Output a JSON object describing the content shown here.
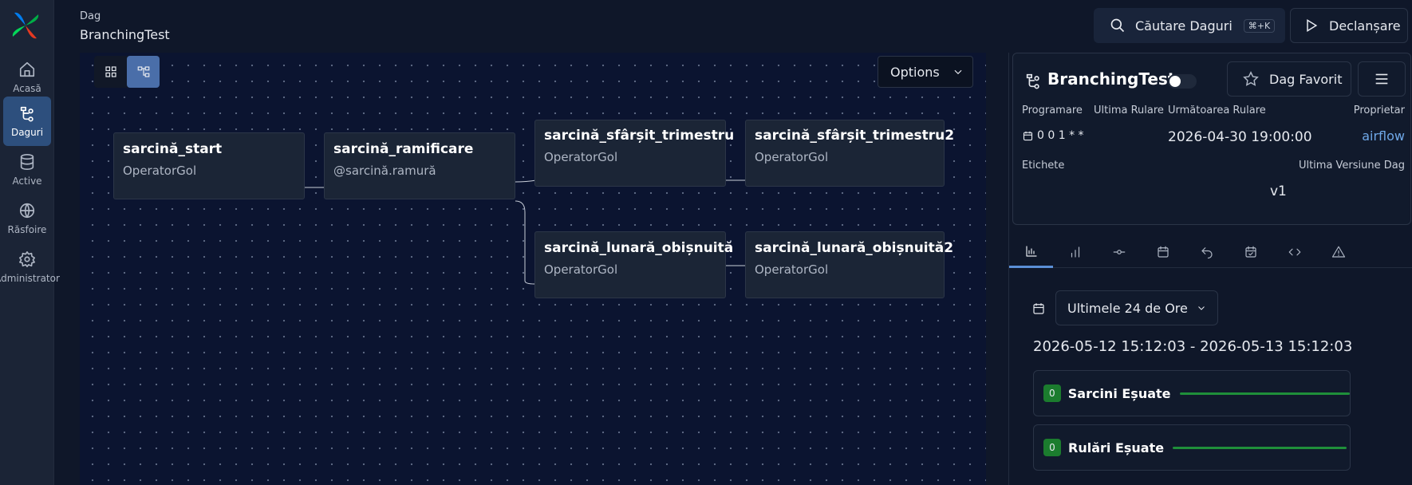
{
  "nav": {
    "items": [
      {
        "label": "Acasă",
        "icon": "home-icon"
      },
      {
        "label": "Daguri",
        "icon": "dag-icon",
        "active": true
      },
      {
        "label": "Active",
        "icon": "database-icon"
      },
      {
        "label": "Răsfoire",
        "icon": "globe-icon"
      },
      {
        "label": "Administrator",
        "icon": "gear-icon"
      }
    ]
  },
  "header": {
    "label": "Dag",
    "title": "BranchingTest",
    "search_label": "Căutare Daguri",
    "search_shortcut": "⌘+K",
    "trigger_label": "Declanșare"
  },
  "canvas": {
    "options_label": "Options",
    "nodes": [
      {
        "name": "sarcină_start",
        "operator": "OperatorGol"
      },
      {
        "name": "sarcină_ramificare",
        "operator": "@sarcină.ramură"
      },
      {
        "name": "sarcină_sfârșit_trimestru",
        "operator": "OperatorGol"
      },
      {
        "name": "sarcină_sfârșit_trimestru2",
        "operator": "OperatorGol"
      },
      {
        "name": "sarcină_lunară_obișnuită",
        "operator": "OperatorGol"
      },
      {
        "name": "sarcină_lunară_obișnuită2",
        "operator": "OperatorGol"
      }
    ]
  },
  "details": {
    "title": "BranchingTest",
    "paused": true,
    "favorite_label": "Dag Favorit",
    "schedule_label": "Programare",
    "schedule_value": "0 0 1 * *",
    "last_run_label": "Ultima Rulare",
    "next_run_label": "Următoarea Rulare",
    "next_run_value": "2026-04-30 19:00:00",
    "owner_label": "Proprietar",
    "owner_value": "airflow",
    "tags_label": "Etichete",
    "version_label": "Ultima Versiune Dag",
    "version_value": "v1"
  },
  "tabs": [
    "overview-icon",
    "bar-chart-icon",
    "commit-icon",
    "calendar-icon",
    "undo-icon",
    "calendar-check-icon",
    "code-icon",
    "warning-icon"
  ],
  "summary": {
    "range_label": "Ultimele 24 de Ore",
    "range_text": "2026-05-12 15:12:03 - 2026-05-13 15:12:03",
    "failed_tasks_count": "0",
    "failed_tasks_label": "Sarcini Eșuate",
    "failed_runs_count": "0",
    "failed_runs_label": "Rulări Eșuate"
  },
  "colors": {
    "accent": "#2d4f7d",
    "link": "#6fa8e8",
    "success": "#1b7c2e"
  }
}
